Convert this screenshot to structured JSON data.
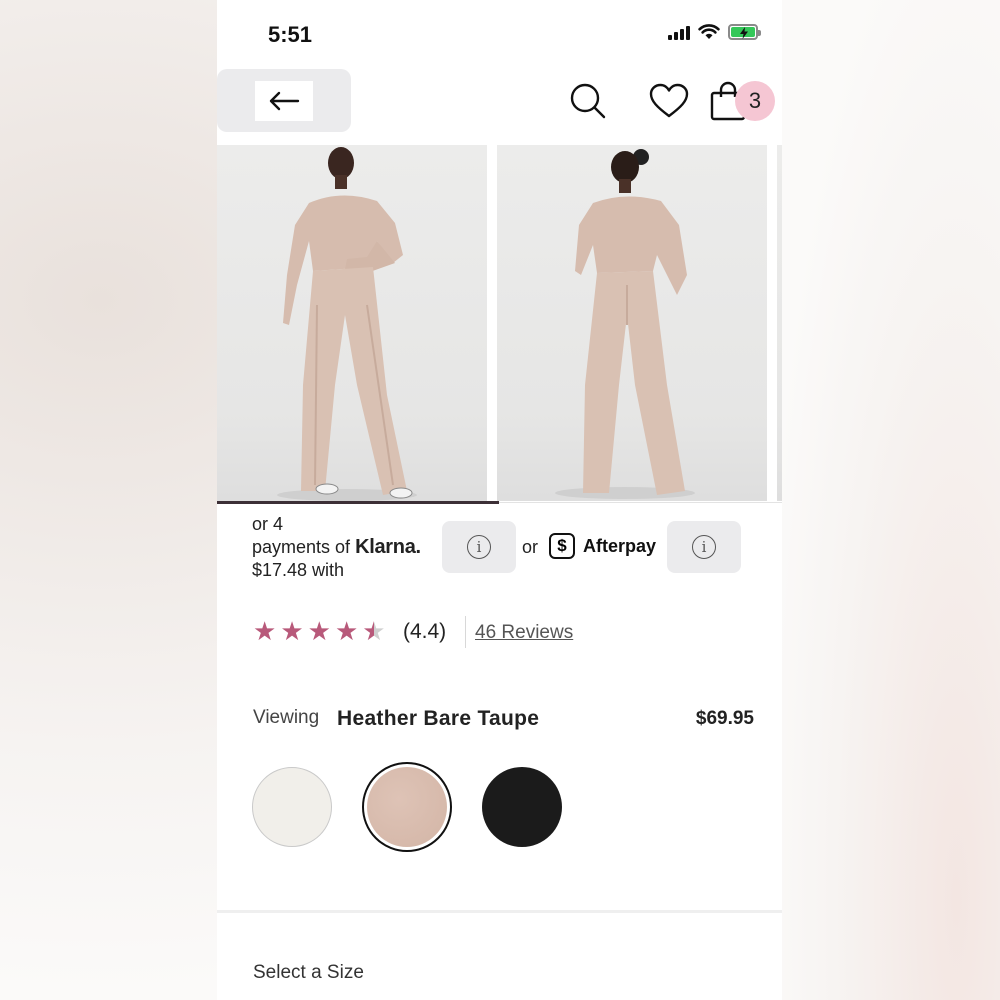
{
  "status_bar": {
    "time": "5:51"
  },
  "header": {
    "back_icon": "arrow-left-icon",
    "search_icon": "search-icon",
    "wishlist_icon": "heart-icon",
    "cart_icon": "shopping-bag-icon",
    "cart_count": "3",
    "badge_color": "#f5c6d3"
  },
  "gallery": {
    "images": [
      "model-front",
      "model-back"
    ],
    "progress": 0.5
  },
  "payments": {
    "klarna_line1": "or 4",
    "klarna_line2": "payments of",
    "klarna_brand": "Klarna.",
    "klarna_line3": "$17.48 with",
    "or_label": "or",
    "afterpay_symbol": "$",
    "afterpay_brand": "Afterpay",
    "info_icon": "i"
  },
  "rating": {
    "value": 4.4,
    "display": "(4.4)",
    "reviews_label": "46 Reviews",
    "star_color": "#b8597a"
  },
  "product": {
    "viewing_label": "Viewing",
    "color_name": "Heather Bare Taupe",
    "price": "$69.95",
    "swatches": [
      {
        "name": "ivory",
        "color": "#f1efea"
      },
      {
        "name": "heather-bare-taupe",
        "color": "#d9bcaf",
        "selected": true
      },
      {
        "name": "black",
        "color": "#1b1b1b"
      }
    ]
  },
  "size": {
    "label": "Select a Size"
  }
}
